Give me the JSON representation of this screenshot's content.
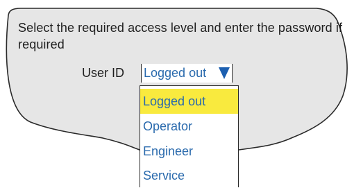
{
  "dialog": {
    "prompt": "Select the required access level and enter the password if required"
  },
  "user_id": {
    "label": "User ID",
    "selected_value": "Logged out",
    "options": [
      {
        "label": "Logged out",
        "selected": true
      },
      {
        "label": "Operator",
        "selected": false
      },
      {
        "label": "Engineer",
        "selected": false
      },
      {
        "label": "Service",
        "selected": false
      }
    ]
  },
  "colors": {
    "bubble_fill": "#e6e6e6",
    "outline": "#2a2a2a",
    "value_text": "#2a6aad",
    "highlight": "#f9ea3e",
    "arrow": "#1c5fb0"
  },
  "icons": {
    "dropdown_arrow": "triangle-down-icon"
  }
}
